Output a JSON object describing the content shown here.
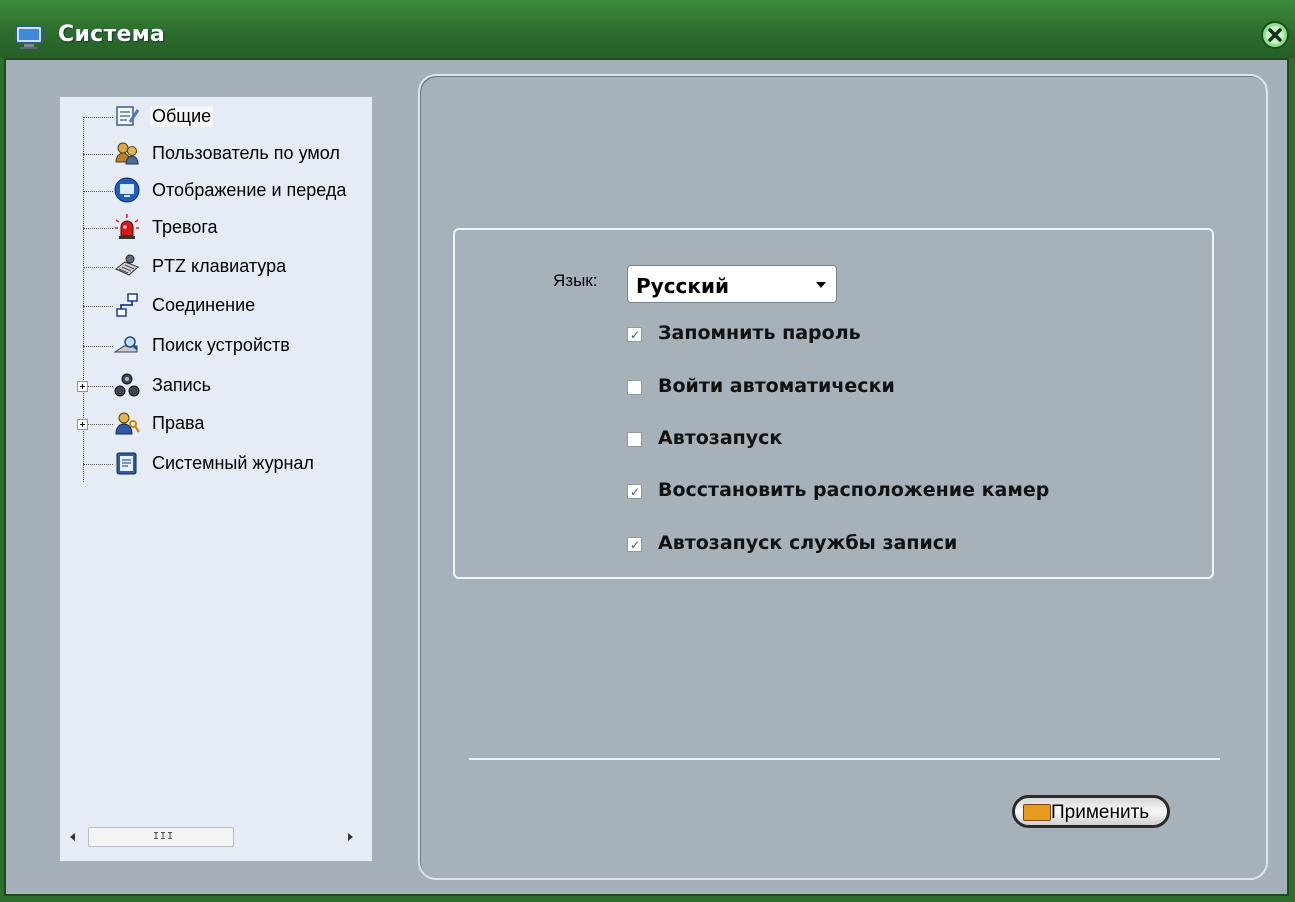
{
  "window": {
    "title": "Система"
  },
  "tree": {
    "items": [
      {
        "label": "Общие",
        "icon": "document-edit-icon"
      },
      {
        "label": "Пользователь по умол",
        "icon": "users-icon"
      },
      {
        "label": "Отображение и переда",
        "icon": "monitor-icon"
      },
      {
        "label": "Тревога",
        "icon": "alarm-icon"
      },
      {
        "label": "PTZ клавиатура",
        "icon": "keyboard-icon"
      },
      {
        "label": "Соединение",
        "icon": "network-icon"
      },
      {
        "label": "Поиск устройств",
        "icon": "device-search-icon"
      },
      {
        "label": "Запись",
        "icon": "record-icon"
      },
      {
        "label": "Права",
        "icon": "permissions-icon"
      },
      {
        "label": "Системный журнал",
        "icon": "log-icon"
      }
    ],
    "scrollbar": {
      "grip": "III"
    }
  },
  "settings": {
    "language_label": "Язык:",
    "language_value": "Русский",
    "checkboxes": [
      {
        "label": "Запомнить пароль",
        "checked": true
      },
      {
        "label": "Войти автоматически",
        "checked": false
      },
      {
        "label": "Автозапуск",
        "checked": false
      },
      {
        "label": "Восстановить расположение камер",
        "checked": true
      },
      {
        "label": "Автозапуск службы записи",
        "checked": true
      }
    ]
  },
  "footer": {
    "apply_label": "Применить"
  },
  "colors": {
    "titlebar": "#2d6e2d",
    "tree_bg": "#e5ecf6",
    "panel_bg": "#a7b1b9",
    "check": "#2255c8"
  }
}
